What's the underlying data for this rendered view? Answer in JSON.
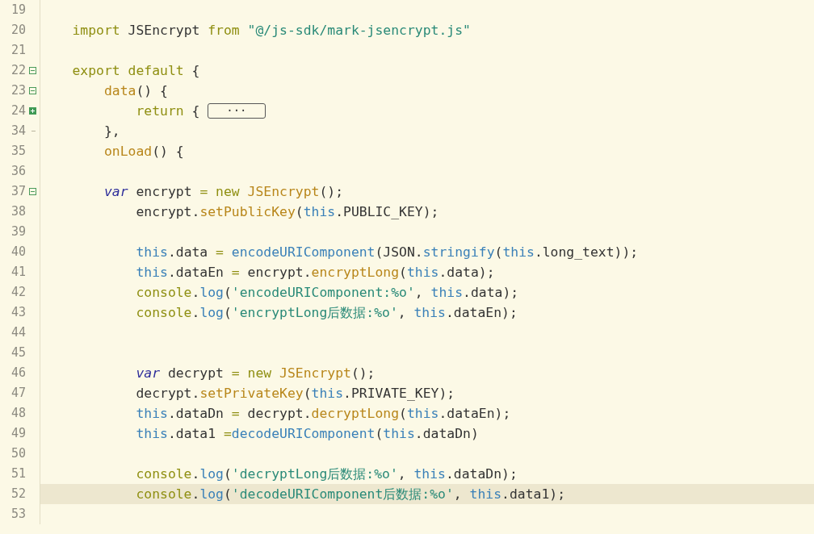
{
  "editor": {
    "lines": [
      {
        "number": "19",
        "current": false
      },
      {
        "number": "20",
        "current": false,
        "tokens": [
          {
            "kind": "keyword",
            "text": "    import "
          },
          {
            "kind": "plain",
            "text": "JSEncrypt "
          },
          {
            "kind": "keyword",
            "text": "from "
          },
          {
            "kind": "string",
            "text": "\"@/js-sdk/mark-jsencrypt.js\""
          }
        ]
      },
      {
        "number": "21",
        "current": false
      },
      {
        "number": "22",
        "collapsible": true,
        "collapsed": false,
        "current": false,
        "tokens": [
          {
            "kind": "keyword",
            "text": "    export default"
          },
          {
            "kind": "plain",
            "text": " {"
          }
        ]
      },
      {
        "number": "23",
        "collapsible": true,
        "collapsed": false,
        "current": false,
        "tokens": [
          {
            "kind": "method",
            "text": "        data"
          },
          {
            "kind": "plain",
            "text": "() {"
          }
        ]
      },
      {
        "number": "24",
        "collapsible": true,
        "collapsed": true,
        "current": false,
        "tokens": [
          {
            "kind": "keyword",
            "text": "            return"
          },
          {
            "kind": "plain",
            "text": " { "
          },
          {
            "kind": "folded",
            "text": "···"
          }
        ]
      },
      {
        "number": "34",
        "fold_end": true,
        "current": false,
        "tokens": [
          {
            "kind": "plain",
            "text": "        },"
          }
        ]
      },
      {
        "number": "35",
        "current": false,
        "tokens": [
          {
            "kind": "method",
            "text": "        onLoad"
          },
          {
            "kind": "plain",
            "text": "() {"
          }
        ]
      },
      {
        "number": "36",
        "current": false
      },
      {
        "number": "37",
        "collapsible": true,
        "collapsed": false,
        "current": false,
        "tokens": [
          {
            "kind": "storage",
            "text": "        var"
          },
          {
            "kind": "plain",
            "text": " encrypt "
          },
          {
            "kind": "keyword",
            "text": "= new "
          },
          {
            "kind": "method",
            "text": "JSEncrypt"
          },
          {
            "kind": "plain",
            "text": "();"
          }
        ]
      },
      {
        "number": "38",
        "current": false,
        "tokens": [
          {
            "kind": "plain",
            "text": "            encrypt."
          },
          {
            "kind": "method",
            "text": "setPublicKey"
          },
          {
            "kind": "plain",
            "text": "("
          },
          {
            "kind": "builtin",
            "text": "this"
          },
          {
            "kind": "plain",
            "text": ".PUBLIC_KEY);"
          }
        ]
      },
      {
        "number": "39",
        "current": false
      },
      {
        "number": "40",
        "current": false,
        "tokens": [
          {
            "kind": "builtin",
            "text": "            this"
          },
          {
            "kind": "plain",
            "text": ".data "
          },
          {
            "kind": "keyword",
            "text": "= "
          },
          {
            "kind": "builtin",
            "text": "encodeURIComponent"
          },
          {
            "kind": "plain",
            "text": "(JSON."
          },
          {
            "kind": "builtin",
            "text": "stringify"
          },
          {
            "kind": "plain",
            "text": "("
          },
          {
            "kind": "builtin",
            "text": "this"
          },
          {
            "kind": "plain",
            "text": ".long_text));"
          }
        ]
      },
      {
        "number": "41",
        "current": false,
        "tokens": [
          {
            "kind": "builtin",
            "text": "            this"
          },
          {
            "kind": "plain",
            "text": ".dataEn "
          },
          {
            "kind": "keyword",
            "text": "= "
          },
          {
            "kind": "plain",
            "text": "encrypt."
          },
          {
            "kind": "method",
            "text": "encryptLong"
          },
          {
            "kind": "plain",
            "text": "("
          },
          {
            "kind": "builtin",
            "text": "this"
          },
          {
            "kind": "plain",
            "text": ".data);"
          }
        ]
      },
      {
        "number": "42",
        "current": false,
        "tokens": [
          {
            "kind": "keyword",
            "text": "            console"
          },
          {
            "kind": "plain",
            "text": "."
          },
          {
            "kind": "builtin",
            "text": "log"
          },
          {
            "kind": "plain",
            "text": "("
          },
          {
            "kind": "string",
            "text": "'encodeURIComponent:%o'"
          },
          {
            "kind": "plain",
            "text": ", "
          },
          {
            "kind": "builtin",
            "text": "this"
          },
          {
            "kind": "plain",
            "text": ".data);"
          }
        ]
      },
      {
        "number": "43",
        "current": false,
        "tokens": [
          {
            "kind": "keyword",
            "text": "            console"
          },
          {
            "kind": "plain",
            "text": "."
          },
          {
            "kind": "builtin",
            "text": "log"
          },
          {
            "kind": "plain",
            "text": "("
          },
          {
            "kind": "string",
            "text": "'encryptLong后数据:%o'"
          },
          {
            "kind": "plain",
            "text": ", "
          },
          {
            "kind": "builtin",
            "text": "this"
          },
          {
            "kind": "plain",
            "text": ".dataEn);"
          }
        ]
      },
      {
        "number": "44",
        "current": false
      },
      {
        "number": "45",
        "current": false
      },
      {
        "number": "46",
        "current": false,
        "tokens": [
          {
            "kind": "storage",
            "text": "            var"
          },
          {
            "kind": "plain",
            "text": " decrypt "
          },
          {
            "kind": "keyword",
            "text": "= new "
          },
          {
            "kind": "method",
            "text": "JSEncrypt"
          },
          {
            "kind": "plain",
            "text": "();"
          }
        ]
      },
      {
        "number": "47",
        "current": false,
        "tokens": [
          {
            "kind": "plain",
            "text": "            decrypt."
          },
          {
            "kind": "method",
            "text": "setPrivateKey"
          },
          {
            "kind": "plain",
            "text": "("
          },
          {
            "kind": "builtin",
            "text": "this"
          },
          {
            "kind": "plain",
            "text": ".PRIVATE_KEY);"
          }
        ]
      },
      {
        "number": "48",
        "current": false,
        "tokens": [
          {
            "kind": "builtin",
            "text": "            this"
          },
          {
            "kind": "plain",
            "text": ".dataDn "
          },
          {
            "kind": "keyword",
            "text": "= "
          },
          {
            "kind": "plain",
            "text": "decrypt."
          },
          {
            "kind": "method",
            "text": "decryptLong"
          },
          {
            "kind": "plain",
            "text": "("
          },
          {
            "kind": "builtin",
            "text": "this"
          },
          {
            "kind": "plain",
            "text": ".dataEn);"
          }
        ]
      },
      {
        "number": "49",
        "current": false,
        "tokens": [
          {
            "kind": "builtin",
            "text": "            this"
          },
          {
            "kind": "plain",
            "text": ".data1 "
          },
          {
            "kind": "keyword",
            "text": "="
          },
          {
            "kind": "builtin",
            "text": "decodeURIComponent"
          },
          {
            "kind": "plain",
            "text": "("
          },
          {
            "kind": "builtin",
            "text": "this"
          },
          {
            "kind": "plain",
            "text": ".dataDn)"
          }
        ]
      },
      {
        "number": "50",
        "current": false
      },
      {
        "number": "51",
        "current": false,
        "tokens": [
          {
            "kind": "keyword",
            "text": "            console"
          },
          {
            "kind": "plain",
            "text": "."
          },
          {
            "kind": "builtin",
            "text": "log"
          },
          {
            "kind": "plain",
            "text": "("
          },
          {
            "kind": "string",
            "text": "'decryptLong后数据:%o'"
          },
          {
            "kind": "plain",
            "text": ", "
          },
          {
            "kind": "builtin",
            "text": "this"
          },
          {
            "kind": "plain",
            "text": ".dataDn);"
          }
        ]
      },
      {
        "number": "52",
        "current": true,
        "tokens": [
          {
            "kind": "keyword",
            "text": "            console"
          },
          {
            "kind": "plain",
            "text": "."
          },
          {
            "kind": "builtin",
            "text": "log"
          },
          {
            "kind": "plain",
            "text": "("
          },
          {
            "kind": "string",
            "text": "'decodeURIComponent后数据:%o'"
          },
          {
            "kind": "plain",
            "text": ", "
          },
          {
            "kind": "builtin",
            "text": "this"
          },
          {
            "kind": "plain",
            "text": ".data1);"
          }
        ]
      },
      {
        "number": "53",
        "current": false
      }
    ]
  }
}
